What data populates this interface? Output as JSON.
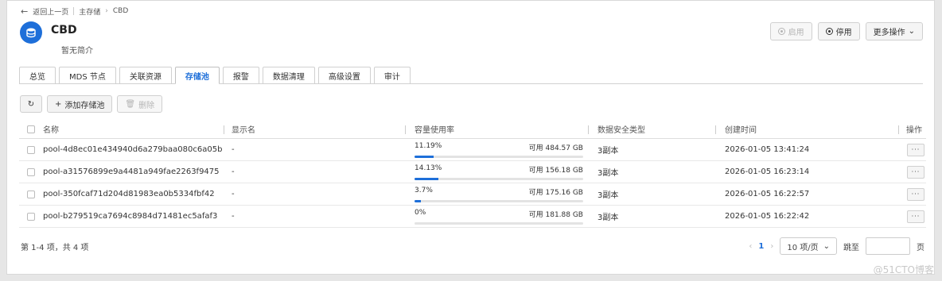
{
  "breadcrumb": {
    "back": "返回上一页",
    "parent": "主存储",
    "current": "CBD"
  },
  "header": {
    "title": "CBD",
    "subtitle": "暂无简介"
  },
  "actions": {
    "enable": "启用",
    "disable": "停用",
    "more": "更多操作"
  },
  "tabs": [
    {
      "label": "总览"
    },
    {
      "label": "MDS 节点"
    },
    {
      "label": "关联资源"
    },
    {
      "label": "存储池",
      "active": true
    },
    {
      "label": "报警"
    },
    {
      "label": "数据清理"
    },
    {
      "label": "高级设置"
    },
    {
      "label": "审计"
    }
  ],
  "toolbar": {
    "add": "添加存储池",
    "delete": "删除"
  },
  "table": {
    "columns": [
      "名称",
      "显示名",
      "容量使用率",
      "数据安全类型",
      "创建时间",
      "操作"
    ],
    "rows": [
      {
        "name": "pool-4d8ec01e434940d6a279baa080c6a05b",
        "display": "-",
        "usage": "11.19%",
        "usage_frac": 0.1119,
        "avail": "可用 484.57 GB",
        "type": "3副本",
        "created": "2026-01-05 13:41:24",
        "op": "···"
      },
      {
        "name": "pool-a31576899e9a4481a949fae2263f9475",
        "display": "-",
        "usage": "14.13%",
        "usage_frac": 0.1413,
        "avail": "可用 156.18 GB",
        "type": "3副本",
        "created": "2026-01-05 16:23:14",
        "op": "···"
      },
      {
        "name": "pool-350fcaf71d204d81983ea0b5334fbf42",
        "display": "-",
        "usage": "3.7%",
        "usage_frac": 0.037,
        "avail": "可用 175.16 GB",
        "type": "3副本",
        "created": "2026-01-05 16:22:57",
        "op": "···"
      },
      {
        "name": "pool-b279519ca7694c8984d71481ec5afaf3",
        "display": "-",
        "usage": "0%",
        "usage_frac": 0,
        "avail": "可用 181.88 GB",
        "type": "3副本",
        "created": "2026-01-05 16:22:42",
        "op": "···"
      }
    ]
  },
  "footer": {
    "summary": "第 1-4 项，共 4 项",
    "page": "1",
    "page_size": "10 项/页",
    "goto": "跳至",
    "page_unit": "页"
  },
  "watermark": "@51CTO博客",
  "colors": {
    "accent": "#1e6fd9"
  }
}
